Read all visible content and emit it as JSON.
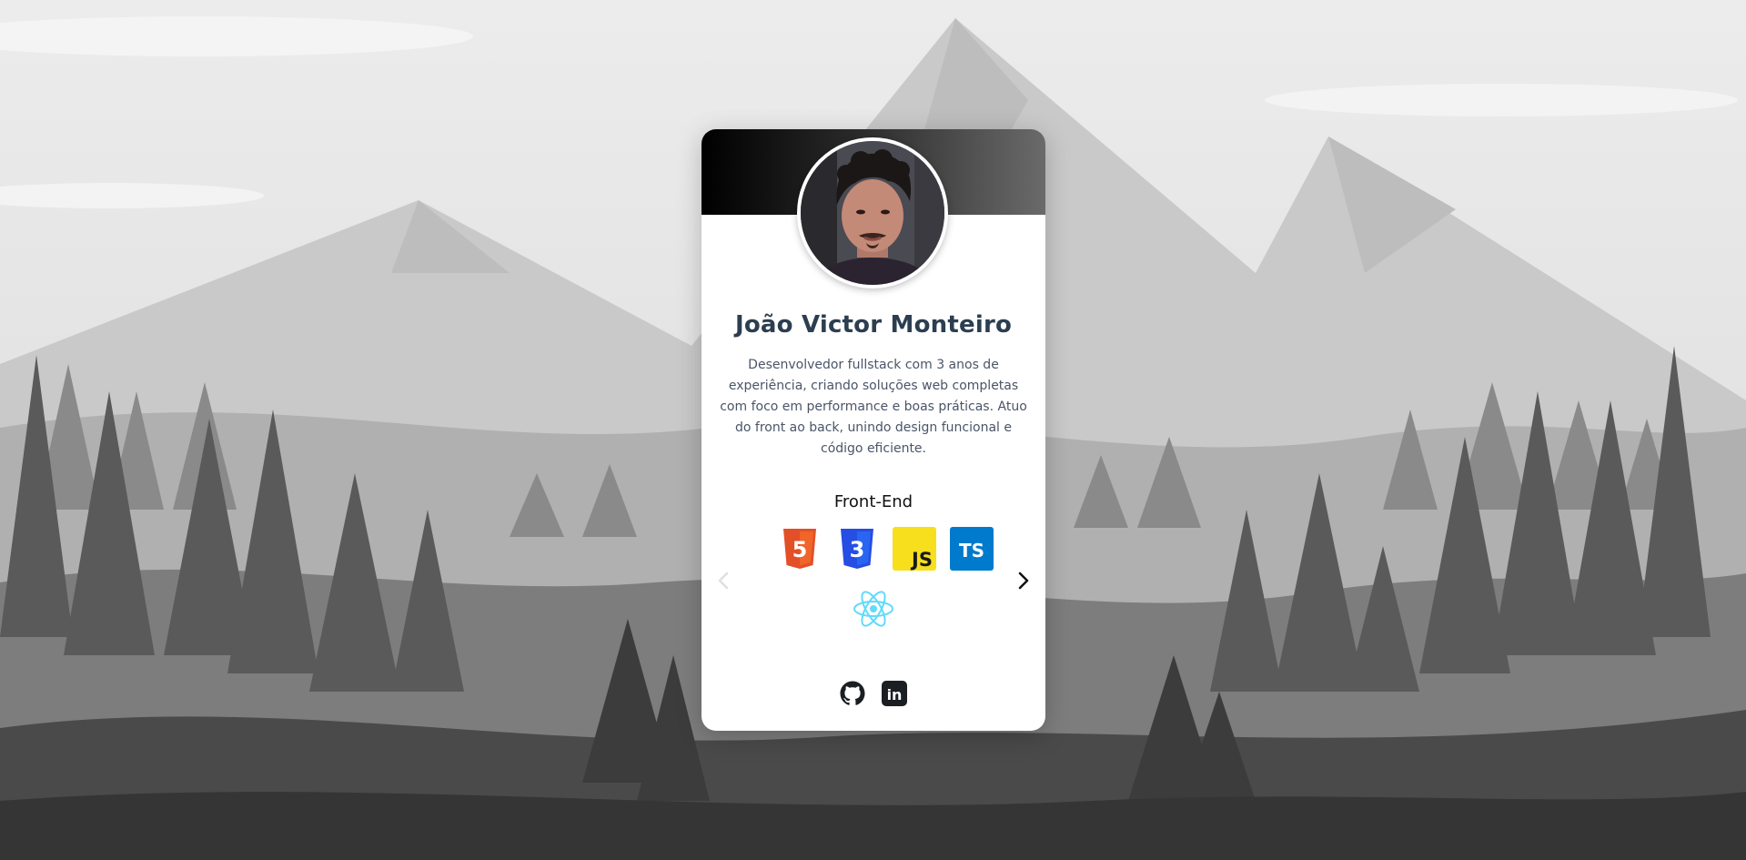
{
  "profile": {
    "name": "João Victor Monteiro",
    "bio": "Desenvolvedor fullstack com 3 anos de experiência, criando soluções web completas com foco em performance e boas práticas. Atuo do front ao back, unindo design funcional e código eficiente."
  },
  "skills": {
    "section_title": "Front-End",
    "items": [
      {
        "icon": "html5-icon",
        "label": "5",
        "color": "#e34f26"
      },
      {
        "icon": "css3-icon",
        "label": "3",
        "color": "#264de4"
      },
      {
        "icon": "javascript-icon",
        "label": "JS",
        "color": "#f7df1e"
      },
      {
        "icon": "typescript-icon",
        "label": "TS",
        "color": "#007acc"
      },
      {
        "icon": "react-icon",
        "label": "",
        "color": "#61dafb"
      }
    ]
  },
  "carousel": {
    "prev_icon": "chevron-left-icon",
    "next_icon": "chevron-right-icon"
  },
  "socials": [
    {
      "icon": "github-icon"
    },
    {
      "icon": "linkedin-icon",
      "label": "in"
    }
  ],
  "colors": {
    "name": "#2c3e50",
    "banner_start": "#000000",
    "banner_end": "#6a6a6a"
  }
}
